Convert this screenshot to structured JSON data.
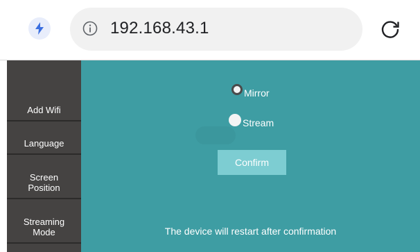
{
  "browser": {
    "url": "192.168.43.1",
    "accent_color": "#3b6fe0"
  },
  "sidebar": {
    "items": [
      {
        "label": "Add Wifi"
      },
      {
        "label": "Language"
      },
      {
        "label_line1": "Screen",
        "label_line2": "Position"
      },
      {
        "label_line1": "Streaming",
        "label_line2": "Mode"
      }
    ]
  },
  "main": {
    "options": [
      {
        "label": "Mirror",
        "checked": true
      },
      {
        "label": "Stream",
        "checked": false
      }
    ],
    "confirm_label": "Confirm",
    "notice": "The device will restart after confirmation"
  },
  "icons": {
    "lightning": "lightning-icon",
    "info": "info-icon",
    "reload": "reload-icon"
  },
  "colors": {
    "sidebar_bg": "#454342",
    "content_bg": "#3e9da3",
    "button_bg": "#7dcdd2"
  }
}
